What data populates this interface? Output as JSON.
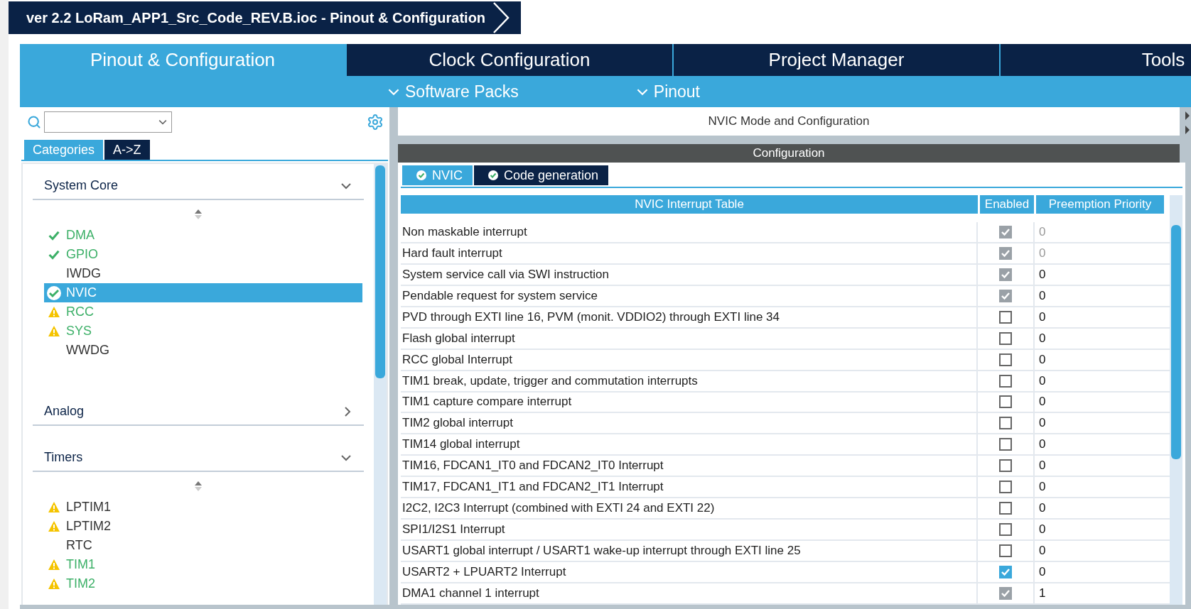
{
  "window": {
    "title": "ver 2.2 LoRam_APP1_Src_Code_REV.B.ioc - Pinout & Configuration"
  },
  "main_tabs": [
    {
      "label": "Pinout & Configuration",
      "selected": true
    },
    {
      "label": "Clock Configuration",
      "selected": false
    },
    {
      "label": "Project Manager",
      "selected": false
    },
    {
      "label": "Tools",
      "selected": false
    }
  ],
  "sub_menus": [
    "Software Packs",
    "Pinout"
  ],
  "view_tabs": [
    {
      "label": "Categories",
      "selected": true
    },
    {
      "label": "A->Z",
      "selected": false
    }
  ],
  "categories": [
    {
      "name": "System Core",
      "expanded": true,
      "items": [
        {
          "label": "DMA",
          "kind": "ok",
          "configured": true,
          "selected": false
        },
        {
          "label": "GPIO",
          "kind": "ok",
          "configured": true,
          "selected": false
        },
        {
          "label": "IWDG",
          "kind": "plain",
          "configured": false,
          "selected": false
        },
        {
          "label": "NVIC",
          "kind": "ok",
          "configured": true,
          "selected": true
        },
        {
          "label": "RCC",
          "kind": "warning",
          "configured": true,
          "selected": false
        },
        {
          "label": "SYS",
          "kind": "warning",
          "configured": true,
          "selected": false
        },
        {
          "label": "WWDG",
          "kind": "plain",
          "configured": false,
          "selected": false
        }
      ]
    },
    {
      "name": "Analog",
      "expanded": false
    },
    {
      "name": "Timers",
      "expanded": true,
      "items": [
        {
          "label": "LPTIM1",
          "kind": "warning",
          "configured": false,
          "selected": false
        },
        {
          "label": "LPTIM2",
          "kind": "warning",
          "configured": false,
          "selected": false
        },
        {
          "label": "RTC",
          "kind": "plain",
          "configured": false,
          "selected": false
        },
        {
          "label": "TIM1",
          "kind": "warning",
          "configured": true,
          "selected": false
        },
        {
          "label": "TIM2",
          "kind": "warning",
          "configured": true,
          "selected": false
        }
      ]
    }
  ],
  "mode_panel": {
    "title": "NVIC Mode and Configuration"
  },
  "configuration": {
    "title": "Configuration",
    "tabs": [
      {
        "label": "NVIC",
        "selected": true
      },
      {
        "label": "Code generation",
        "selected": false
      }
    ],
    "table": {
      "columns": [
        "NVIC Interrupt Table",
        "Enabled",
        "Preemption Priority"
      ],
      "rows": [
        {
          "name": "Non maskable interrupt",
          "enabled": true,
          "disabled": true,
          "priority": "0",
          "priority_disabled": true
        },
        {
          "name": "Hard fault interrupt",
          "enabled": true,
          "disabled": true,
          "priority": "0",
          "priority_disabled": true
        },
        {
          "name": "System service call via SWI instruction",
          "enabled": true,
          "disabled": true,
          "priority": "0",
          "priority_disabled": false
        },
        {
          "name": "Pendable request for system service",
          "enabled": true,
          "disabled": true,
          "priority": "0",
          "priority_disabled": false
        },
        {
          "name": "PVD through EXTI line 16, PVM (monit. VDDIO2) through EXTI line 34",
          "enabled": false,
          "disabled": false,
          "priority": "0",
          "priority_disabled": false
        },
        {
          "name": "Flash global interrupt",
          "enabled": false,
          "disabled": false,
          "priority": "0",
          "priority_disabled": false
        },
        {
          "name": "RCC global Interrupt",
          "enabled": false,
          "disabled": false,
          "priority": "0",
          "priority_disabled": false
        },
        {
          "name": "TIM1 break, update, trigger and commutation interrupts",
          "enabled": false,
          "disabled": false,
          "priority": "0",
          "priority_disabled": false
        },
        {
          "name": "TIM1 capture compare interrupt",
          "enabled": false,
          "disabled": false,
          "priority": "0",
          "priority_disabled": false
        },
        {
          "name": "TIM2 global interrupt",
          "enabled": false,
          "disabled": false,
          "priority": "0",
          "priority_disabled": false
        },
        {
          "name": "TIM14 global interrupt",
          "enabled": false,
          "disabled": false,
          "priority": "0",
          "priority_disabled": false
        },
        {
          "name": "TIM16, FDCAN1_IT0 and FDCAN2_IT0 Interrupt",
          "enabled": false,
          "disabled": false,
          "priority": "0",
          "priority_disabled": false
        },
        {
          "name": "TIM17, FDCAN1_IT1 and FDCAN2_IT1 Interrupt",
          "enabled": false,
          "disabled": false,
          "priority": "0",
          "priority_disabled": false
        },
        {
          "name": "I2C2, I2C3 Interrupt (combined with EXTI 24 and EXTI 22)",
          "enabled": false,
          "disabled": false,
          "priority": "0",
          "priority_disabled": false
        },
        {
          "name": "SPI1/I2S1 Interrupt",
          "enabled": false,
          "disabled": false,
          "priority": "0",
          "priority_disabled": false
        },
        {
          "name": "USART1 global interrupt / USART1 wake-up interrupt through EXTI line 25",
          "enabled": false,
          "disabled": false,
          "priority": "0",
          "priority_disabled": false
        },
        {
          "name": "USART2 + LPUART2 Interrupt",
          "enabled": true,
          "disabled": false,
          "priority": "0",
          "priority_disabled": false
        },
        {
          "name": "DMA1 channel 1 interrupt",
          "enabled": true,
          "disabled": true,
          "priority": "1",
          "priority_disabled": false
        }
      ]
    }
  }
}
